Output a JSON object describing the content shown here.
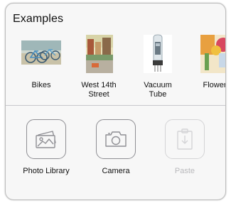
{
  "picker": {
    "title": "Examples",
    "examples": [
      {
        "label_line1": "Bikes",
        "label_line2": ""
      },
      {
        "label_line1": "West 14th",
        "label_line2": "Street"
      },
      {
        "label_line1": "Vacuum",
        "label_line2": "Tube"
      },
      {
        "label_line1": "Flower",
        "label_line2": ""
      }
    ],
    "actions": [
      {
        "label": "Photo Library",
        "icon": "photo-library-icon",
        "enabled": true
      },
      {
        "label": "Camera",
        "icon": "camera-icon",
        "enabled": true
      },
      {
        "label": "Paste",
        "icon": "paste-icon",
        "enabled": false
      }
    ]
  },
  "colors": {
    "panel_background": "#f7f7f7",
    "icon_stroke": "#8e8e93",
    "disabled_stroke": "#d4d4d6",
    "disabled_text": "#b9b9bc"
  }
}
